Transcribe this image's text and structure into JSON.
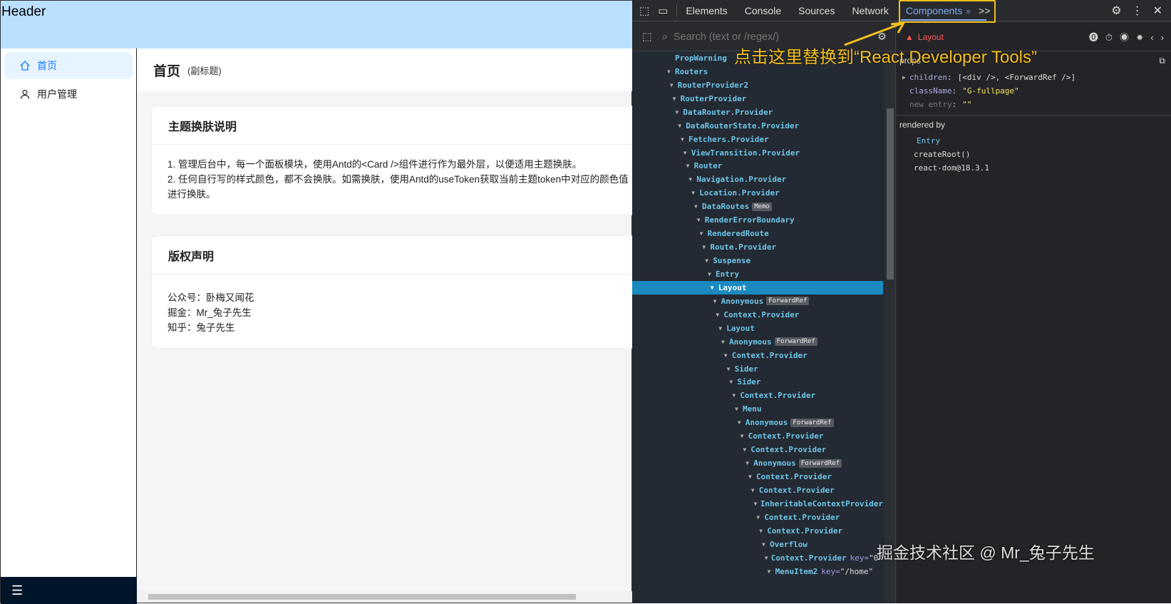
{
  "app": {
    "header": "Header",
    "menu": [
      {
        "label": "首页",
        "icon": "home-icon"
      },
      {
        "label": "用户管理",
        "icon": "user-icon"
      }
    ],
    "collapse_icon": "menu-fold-icon",
    "page_title": "首页",
    "page_subtitle": "(副标题)",
    "cards": [
      {
        "title": "主题换肤说明",
        "lines": [
          "1. 管理后台中，每一个面板模块，使用Antd的<Card />组件进行作为最外层，以便适用主题换肤。",
          "2. 任何自行写的样式颜色，都不会换肤。如需换肤，使用Antd的useToken获取当前主题token中对应的颜色值进行换肤。"
        ]
      },
      {
        "title": "版权声明",
        "lines": [
          "公众号：卧梅又闻花",
          "掘金：Mr_兔子先生",
          "知乎：兔子先生"
        ]
      }
    ]
  },
  "devtools": {
    "tabs": [
      "Elements",
      "Console",
      "Sources",
      "Network",
      "Components"
    ],
    "active_tab": "Components",
    "more": ">>",
    "search_placeholder": "Search (text or /regex/)",
    "selected_component": "Layout",
    "tree": [
      {
        "name": "PropWarning",
        "d": 0,
        "leaf": true
      },
      {
        "name": "Routers",
        "d": 0
      },
      {
        "name": "RouterProvider2",
        "d": 1
      },
      {
        "name": "RouterProvider",
        "d": 2
      },
      {
        "name": "DataRouter.Provider",
        "d": 3
      },
      {
        "name": "DataRouterState.Provider",
        "d": 4
      },
      {
        "name": "Fetchers.Provider",
        "d": 5
      },
      {
        "name": "ViewTransition.Provider",
        "d": 6
      },
      {
        "name": "Router",
        "d": 7
      },
      {
        "name": "Navigation.Provider",
        "d": 8
      },
      {
        "name": "Location.Provider",
        "d": 9
      },
      {
        "name": "DataRoutes",
        "d": 10,
        "badge": "Memo"
      },
      {
        "name": "RenderErrorBoundary",
        "d": 11
      },
      {
        "name": "RenderedRoute",
        "d": 12
      },
      {
        "name": "Route.Provider",
        "d": 13
      },
      {
        "name": "Suspense",
        "d": 14
      },
      {
        "name": "Entry",
        "d": 15
      },
      {
        "name": "Layout",
        "d": 16,
        "selected": true
      },
      {
        "name": "Anonymous",
        "d": 17,
        "badge": "ForwardRef"
      },
      {
        "name": "Context.Provider",
        "d": 18
      },
      {
        "name": "Layout",
        "d": 19
      },
      {
        "name": "Anonymous",
        "d": 20,
        "badge": "ForwardRef"
      },
      {
        "name": "Context.Provider",
        "d": 21
      },
      {
        "name": "Sider",
        "d": 22
      },
      {
        "name": "Sider",
        "d": 23
      },
      {
        "name": "Context.Provider",
        "d": 24
      },
      {
        "name": "Menu",
        "d": 25
      },
      {
        "name": "Anonymous",
        "d": 26,
        "badge": "ForwardRef"
      },
      {
        "name": "Context.Provider",
        "d": 27
      },
      {
        "name": "Context.Provider",
        "d": 28
      },
      {
        "name": "Anonymous",
        "d": 29,
        "badge": "ForwardRef"
      },
      {
        "name": "Context.Provider",
        "d": 30
      },
      {
        "name": "Context.Provider",
        "d": 31
      },
      {
        "name": "InheritableContextProvider",
        "d": 32
      },
      {
        "name": "Context.Provider",
        "d": 33
      },
      {
        "name": "Context.Provider",
        "d": 34
      },
      {
        "name": "Overflow",
        "d": 35
      },
      {
        "name": "Context.Provider",
        "d": 36,
        "key": "\"0\""
      },
      {
        "name": "MenuItem2",
        "d": 37,
        "key": "\"/home\""
      }
    ],
    "props_label": "props",
    "props": [
      {
        "k": "children",
        "v": "[<div />, <ForwardRef />]",
        "expand": true
      },
      {
        "k": "className",
        "v": "\"G-fullpage\""
      },
      {
        "k": "new entry",
        "v": "\"\"",
        "muted": true
      }
    ],
    "rendered_by_label": "rendered by",
    "rendered_by": [
      "Entry",
      "createRoot()",
      "react-dom@18.3.1"
    ]
  },
  "annotation": "点击这里替换到“React Developer Tools”",
  "watermark": "掘金技术社区 @ Mr_兔子先生"
}
